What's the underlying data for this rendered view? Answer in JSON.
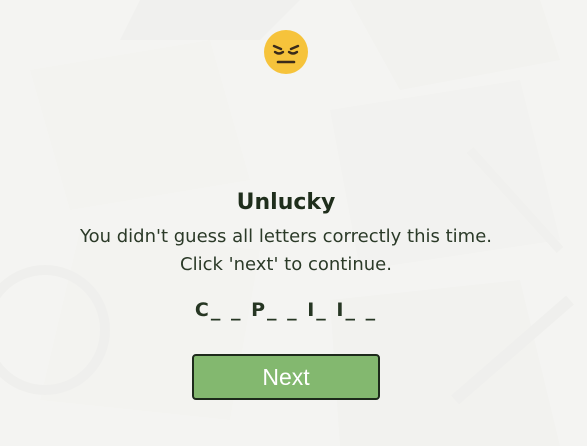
{
  "result": {
    "emoji_icon": "sad-face-icon",
    "title": "Unlucky",
    "message_line1": "You didn't guess all letters correctly this time.",
    "message_line2": "Click 'next' to continue.",
    "word_hint": "C_ _ P_ _ I_ I_ _"
  },
  "actions": {
    "next_label": "Next"
  },
  "colors": {
    "button_bg": "#83b86f",
    "button_border": "#1d2a1b",
    "emoji_face": "#f6c33b",
    "title_text": "#1f2e1c"
  }
}
